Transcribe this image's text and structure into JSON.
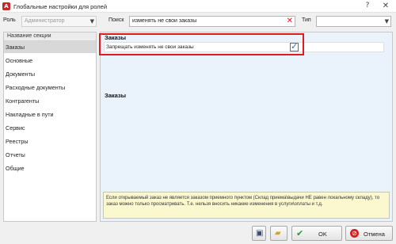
{
  "window": {
    "title": "Глобальные настройки для ролей",
    "help_label": "?",
    "close_label": "✕"
  },
  "toolbar": {
    "role_label": "Роль",
    "role_value": "Администратор",
    "search_label": "Поиск",
    "search_value": "изменять не свои заказы",
    "type_label": "Тип",
    "type_value": ""
  },
  "sidebar": {
    "header": "Название секции",
    "items": [
      {
        "label": "Заказы",
        "selected": true
      },
      {
        "label": "Основные"
      },
      {
        "label": "Документы"
      },
      {
        "label": "Расходные документы"
      },
      {
        "label": "Контрагенты"
      },
      {
        "label": "Накладные в пути"
      },
      {
        "label": "Сервис"
      },
      {
        "label": "Реестры"
      },
      {
        "label": "Отчеты"
      },
      {
        "label": "Общие"
      }
    ]
  },
  "main": {
    "group_title": "Заказы",
    "setting_label": "Запрещать изменять не свои заказы",
    "setting_checked": true,
    "second_title": "Заказы",
    "info_text": "Если открываемый заказ не является заказом приемного пунктом (Склад приема\\выдачи НЕ равен локальному складу), то заказ можно только просматривать. Т.е. нельзя вносить никакие изменения в услуги\\оплаты и т.д."
  },
  "buttons": {
    "ok_label": "OK",
    "cancel_label": "Отмена"
  },
  "colors": {
    "highlight": "#e01b1b",
    "info_background": "#fbf8cf",
    "panel_background": "#eaf3fc",
    "selected_row": "#d8d8d8"
  }
}
